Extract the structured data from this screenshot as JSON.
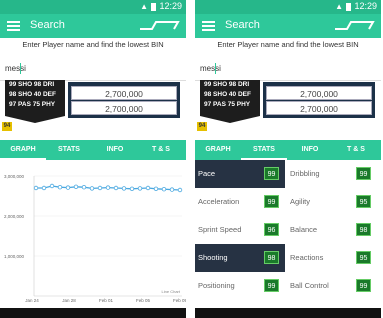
{
  "status": {
    "time": "12:29"
  },
  "appbar": {
    "title": "Search"
  },
  "hint": "Enter Player name and find the lowest BIN",
  "search": {
    "value": "messi"
  },
  "card": {
    "stats_lines": [
      "99 SHO 98 DRI",
      "98 SHO 40 DEF",
      "97 PAS 75 PHY"
    ],
    "rating": "94"
  },
  "prices": [
    "2,700,000",
    "2,700,000"
  ],
  "tabs": [
    "GRAPH",
    "STATS",
    "INFO",
    "T & S"
  ],
  "chart_data": {
    "type": "line",
    "x": [
      "Jan 24",
      "Jan 28",
      "Feb 01",
      "Feb 05",
      "Feb 09"
    ],
    "values": [
      2700000,
      2700000,
      2750000,
      2720000,
      2710000,
      2730000,
      2720000,
      2690000,
      2700000,
      2710000,
      2700000,
      2690000,
      2680000,
      2690000,
      2700000,
      2680000,
      2670000,
      2660000,
      2650000
    ],
    "y_ticks": [
      "3,000,000",
      "2,000,000",
      "1,000,000"
    ],
    "ylim": [
      0,
      3000000
    ],
    "footer": "Line Chart",
    "color": "#4aa8e0"
  },
  "stats": [
    {
      "left": {
        "label": "Pace",
        "value": "99"
      },
      "right": {
        "label": "Dribbling",
        "value": "99"
      },
      "dark_left": true,
      "dark_right": false
    },
    {
      "left": {
        "label": "Acceleration",
        "value": "99"
      },
      "right": {
        "label": "Agility",
        "value": "95"
      },
      "dark_left": false,
      "dark_right": false
    },
    {
      "left": {
        "label": "Sprint Speed",
        "value": "96"
      },
      "right": {
        "label": "Balance",
        "value": "98"
      },
      "dark_left": false,
      "dark_right": false
    },
    {
      "left": {
        "label": "Shooting",
        "value": "98"
      },
      "right": {
        "label": "Reactions",
        "value": "95"
      },
      "dark_left": true,
      "dark_right": false
    },
    {
      "left": {
        "label": "Positioning",
        "value": "99"
      },
      "right": {
        "label": "Ball Control",
        "value": "99"
      },
      "dark_left": false,
      "dark_right": false
    }
  ],
  "colors": {
    "brand": "#2ec89a",
    "status": "#26b78a"
  }
}
